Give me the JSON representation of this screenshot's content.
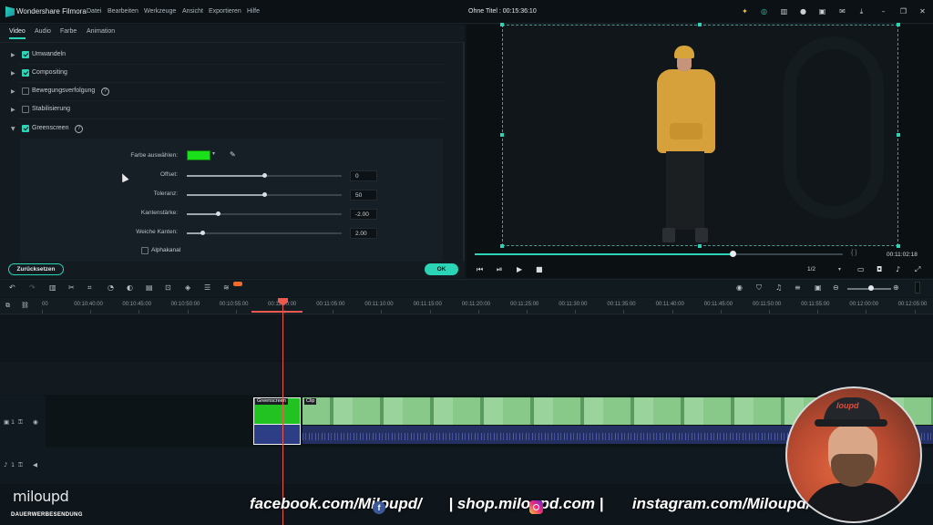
{
  "titlebar": {
    "app_name": "Wondershare Filmora",
    "menu": [
      "Datei",
      "Bearbeiten",
      "Werkzeuge",
      "Ansicht",
      "Exportieren",
      "Hilfe"
    ],
    "document_title": "Ohne Titel : 00:15:36:10"
  },
  "tabs": [
    "Video",
    "Audio",
    "Farbe",
    "Animation"
  ],
  "properties": [
    {
      "label": "Umwandeln",
      "checked": true,
      "expanded": false
    },
    {
      "label": "Compositing",
      "checked": true,
      "expanded": false
    },
    {
      "label": "Bewegungsverfolgung",
      "checked": false,
      "expanded": false
    },
    {
      "label": "Stabilisierung",
      "checked": false,
      "expanded": false
    },
    {
      "label": "Greenscreen",
      "checked": true,
      "expanded": true
    }
  ],
  "greenscreen": {
    "color_label": "Farbe auswählen:",
    "color": "#19e019",
    "sliders": [
      {
        "label": "Offset:",
        "value": "0",
        "fraction": 0.5
      },
      {
        "label": "Toleranz:",
        "value": "50",
        "fraction": 0.5
      },
      {
        "label": "Kantenstärke:",
        "value": "-2.00",
        "fraction": 0.2
      },
      {
        "label": "Weiche Kanten:",
        "value": "2.00",
        "fraction": 0.1
      }
    ],
    "alpha_label": "Alphakanal"
  },
  "buttons": {
    "reset": "Zurücksetzen",
    "ok": "OK"
  },
  "player": {
    "timecode": "00:11:02:18",
    "brackets": "{    }",
    "quality": "1/2",
    "progress_fraction": 0.7
  },
  "timeline": {
    "ticks": [
      "00",
      "00:10:40:00",
      "00:10:45:00",
      "00:10:50:00",
      "00:10:55:00",
      "00:11:00:00",
      "00:11:05:00",
      "00:11:10:00",
      "00:11:15:00",
      "00:11:20:00",
      "00:11:25:00",
      "00:11:30:00",
      "00:11:35:00",
      "00:11:40:00",
      "00:11:45:00",
      "00:11:50:00",
      "00:11:55:00",
      "00:12:00:00",
      "00:12:05:00"
    ],
    "video_track_label": "1",
    "audio_track_label": "1",
    "clip_green_label": "Greenscreen",
    "clip_main_label": "Clip"
  },
  "overlay": {
    "brand": "miloupd",
    "brand_sub": "DAUERWERBESENDUNG",
    "fb_text": "facebook.com/Miloupd/",
    "shop_text": "| shop.miloupd.com |",
    "ig_text": "instagram.com/Miloupd/",
    "cap_text": "loupd"
  },
  "colors": {
    "accent": "#2ad4b5",
    "playhead": "#ec5a4f",
    "greenscreen": "#19e019"
  }
}
